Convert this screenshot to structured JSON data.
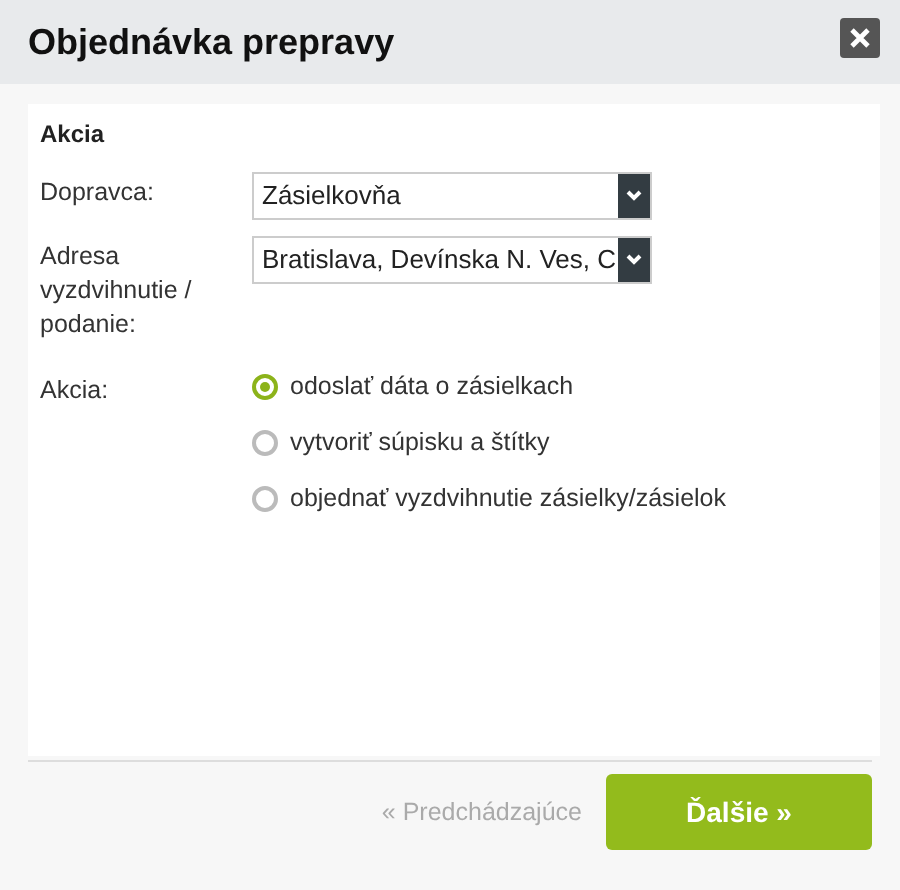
{
  "window": {
    "title": "Objednávka prepravy"
  },
  "section": {
    "title": "Akcia"
  },
  "fields": [
    {
      "label": "Dopravca:",
      "value": "Zásielkovňa"
    },
    {
      "label": "Adresa vyzdvihnutie / podanie:",
      "value": "Bratislava, Devínska N. Ves, C"
    }
  ],
  "action": {
    "label": "Akcia:",
    "options": [
      {
        "label": "odoslať dáta o zásielkach",
        "selected": true
      },
      {
        "label": "vytvoriť súpisku a štítky",
        "selected": false
      },
      {
        "label": "objednať vyzdvihnutie zásielky/zásielok",
        "selected": false
      }
    ]
  },
  "footer": {
    "previous": {
      "label": "« Predchádzajúce",
      "disabled": true
    },
    "next": {
      "label": "Ďalšie »"
    }
  }
}
